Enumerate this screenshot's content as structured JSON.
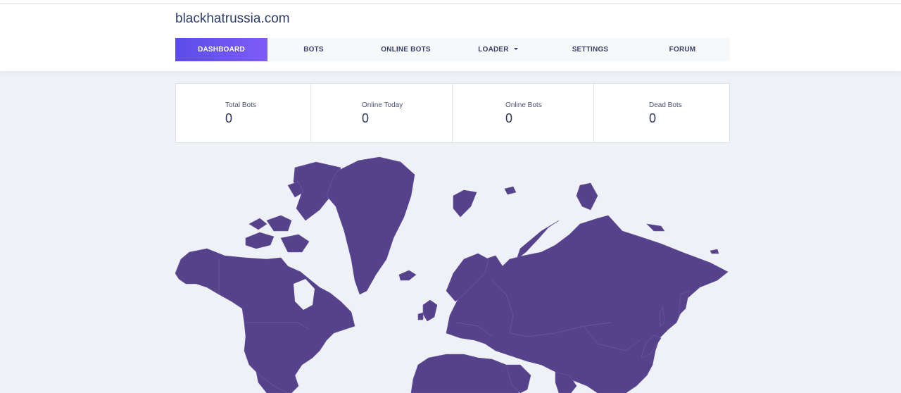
{
  "site": {
    "title": "blackhatrussia.com"
  },
  "nav": {
    "items": [
      {
        "label": "DASHBOARD",
        "active": true
      },
      {
        "label": "BOTS"
      },
      {
        "label": "ONLINE BOTS"
      },
      {
        "label": "LOADER",
        "has_dropdown": true
      },
      {
        "label": "SETTINGS"
      },
      {
        "label": "FORUM"
      }
    ]
  },
  "stats": [
    {
      "label": "Total Bots",
      "value": "0"
    },
    {
      "label": "Online Today",
      "value": "0"
    },
    {
      "label": "Online Bots",
      "value": "0"
    },
    {
      "label": "Dead Bots",
      "value": "0"
    }
  ],
  "colors": {
    "accent_start": "#5b4de8",
    "accent_end": "#7e5cf6",
    "map_fill": "#56428b",
    "brand_text": "#2e3d6b"
  }
}
